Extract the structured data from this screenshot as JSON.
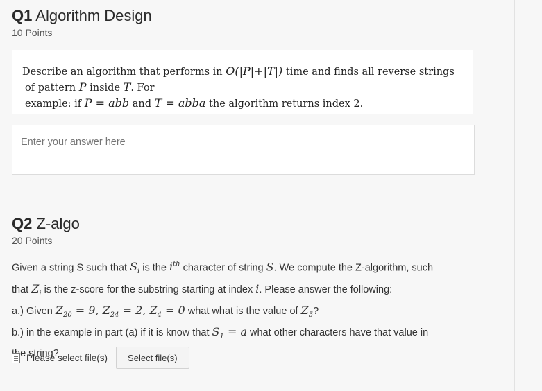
{
  "q1": {
    "number": "Q1",
    "title": "Algorithm Design",
    "points": "10 Points",
    "problem": {
      "line1_a": "Describe an algorithm that performs in ",
      "line1_math": "O(|P|+|T|)",
      "line1_b": " time and finds all reverse strings",
      "line2_a": "of pattern ",
      "line2_P": "P",
      "line2_b": " inside ",
      "line2_T": "T",
      "line2_c": ". For",
      "line3_a": "example: if ",
      "line3_m1": "P = abb",
      "line3_b": " and ",
      "line3_m2": "T = abba",
      "line3_c": " the algorithm returns index 2."
    },
    "answer_placeholder": "Enter your answer here"
  },
  "q2": {
    "number": "Q2",
    "title": "Z-algo",
    "points": "20 Points",
    "body": {
      "l1_a": "Given a string S such that ",
      "l1_m1": "S",
      "l1_m1_sub": "i",
      "l1_b": " is the ",
      "l1_m2": "i",
      "l1_m2_sup": "th",
      "l1_c": " character of string ",
      "l1_m3": "S",
      "l1_d": ". We compute the Z-algorithm, such",
      "l2_a": "that ",
      "l2_m1": "Z",
      "l2_m1_sub": "i",
      "l2_b": " is the z-score for the substring starting at index ",
      "l2_m2": "i",
      "l2_c": ". Please answer the following:",
      "l3_a": "a.) Given ",
      "l3_m": "Z",
      "l3_m_sub1": "20",
      "l3_eq1": " = 9, ",
      "l3_m2": "Z",
      "l3_m_sub2": "24",
      "l3_eq2": " = 2, ",
      "l3_m3": "Z",
      "l3_m_sub3": "4",
      "l3_eq3": " = 0",
      "l3_b": " what what is the value of ",
      "l3_m4": "Z",
      "l3_m_sub4": "5",
      "l3_c": "?",
      "l4_a": "b.) in the example in part (a) if it is know that ",
      "l4_m1": "S",
      "l4_m1_sub": "1",
      "l4_eq": " = ",
      "l4_m2": "a",
      "l4_b": " what other characters have that value in",
      "l5": "the string?"
    },
    "upload_label": "Please select file(s)",
    "select_button": "Select file(s)"
  },
  "icons": {
    "file": "file-icon"
  }
}
